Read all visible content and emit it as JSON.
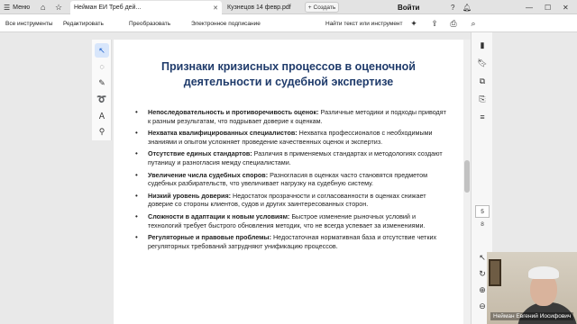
{
  "tabbar": {
    "menu_label": "Меню",
    "tabs": [
      {
        "label": "Нейман ЕИ Треб дей...",
        "active": true
      },
      {
        "label": "Кузнецов 14 февр.pdf",
        "active": false
      }
    ],
    "new_label": "Создать",
    "signin_label": "Войти"
  },
  "menubar": {
    "items": [
      "Все инструменты",
      "Редактировать",
      "Преобразовать",
      "Электронное подписание"
    ],
    "find_label": "Найти текст или инструмент"
  },
  "document": {
    "title": "Признаки кризисных процессов в оценочной деятельности и судебной экспертизе",
    "bullets": [
      {
        "head": "Непоследовательность и противоречивость оценок:",
        "text": " Различные методики и подходы приводят к разным результатам, что подрывает доверие к оценкам."
      },
      {
        "head": "Нехватка квалифицированных специалистов:",
        "text": " Нехватка профессионалов с необходимыми знаниями и опытом усложняет проведение качественных оценок и экспертиз."
      },
      {
        "head": "Отсутствие единых стандартов:",
        "text": " Различия в применяемых стандартах и методологиях создают путаницу и разногласия между специалистами."
      },
      {
        "head": "Увеличение числа судебных споров:",
        "text": " Разногласия в оценках часто становятся предметом судебных разбирательств, что увеличивает нагрузку на судебную систему."
      },
      {
        "head": "Низкий уровень доверия:",
        "text": " Недостаток прозрачности и согласованности в оценках снижает доверие со стороны клиентов, судов и других заинтересованных сторон."
      },
      {
        "head": "Сложности в адаптации к новым условиям:",
        "text": " Быстрое изменение рыночных условий и технологий требует быстрого обновления методик, что не всегда успевает за изменениями."
      },
      {
        "head": "Регуляторные и правовые проблемы:",
        "text": " Недостаточная нормативная база и отсутствие четких регуляторных требований затрудняют унификацию процессов."
      }
    ]
  },
  "pager": {
    "current": "5",
    "total": "8"
  },
  "webcam": {
    "name": "Нейман Евгений Иосифович"
  }
}
